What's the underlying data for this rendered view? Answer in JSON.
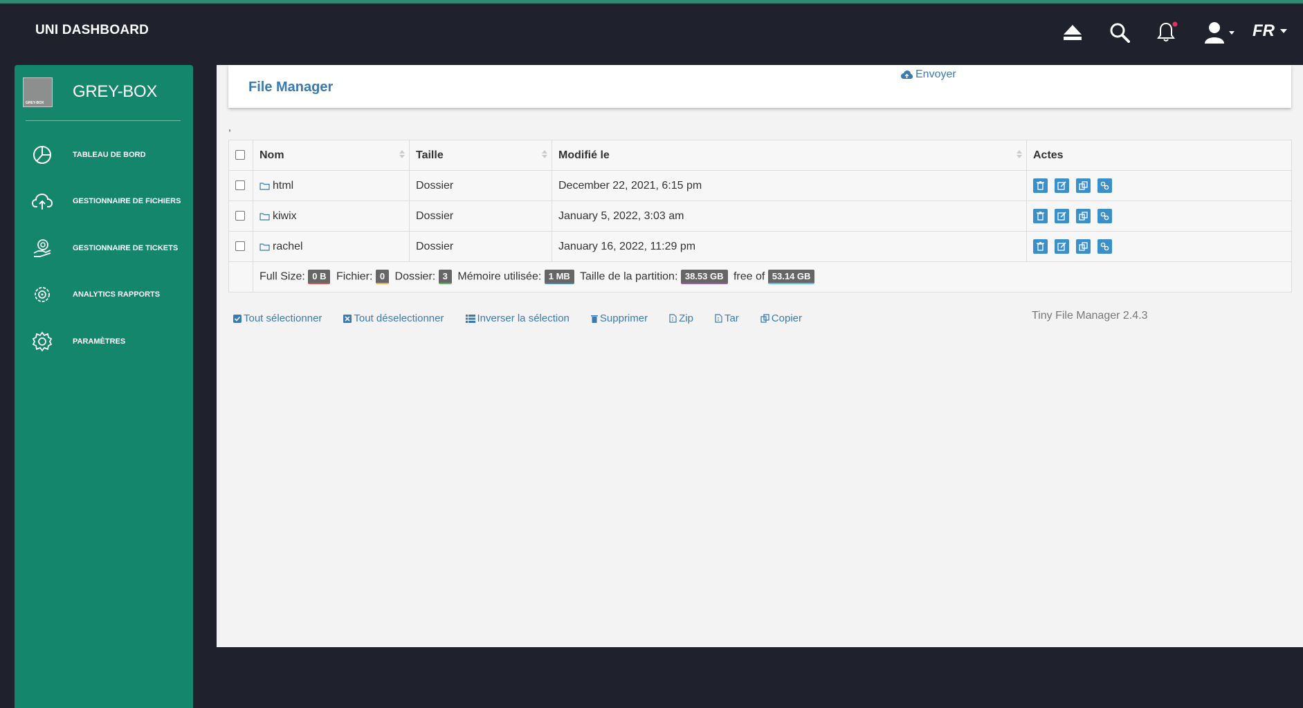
{
  "topbar": {
    "brand": "UNI DASHBOARD",
    "lang": "FR"
  },
  "sidebar": {
    "title": "GREY-BOX",
    "logo_text": "GREY-BOX",
    "items": [
      {
        "label": "TABLEAU DE BORD",
        "icon": "dashboard-icon"
      },
      {
        "label": "GESTIONNAIRE DE FICHIERS",
        "icon": "cloud-upload-icon"
      },
      {
        "label": "GESTIONNAIRE DE TICKETS",
        "icon": "ticket-icon"
      },
      {
        "label": "ANALYTICS RAPPORTS",
        "icon": "analytics-gear-icon"
      },
      {
        "label": "PARAMÈTRES",
        "icon": "settings-icon"
      }
    ]
  },
  "file_manager": {
    "title": "File Manager",
    "upload_label": "Envoyer",
    "tick": ",",
    "columns": {
      "name": "Nom",
      "size": "Taille",
      "modified": "Modifié le",
      "actions": "Actes"
    },
    "rows": [
      {
        "name": "html",
        "size": "Dossier",
        "modified": "December 22, 2021, 6:15 pm"
      },
      {
        "name": "kiwix",
        "size": "Dossier",
        "modified": "January 5, 2022, 3:03 am"
      },
      {
        "name": "rachel",
        "size": "Dossier",
        "modified": "January 16, 2022, 11:29 pm"
      }
    ],
    "summary": {
      "full_size_label": "Full Size:",
      "full_size": "0 B",
      "files_label": "Fichier:",
      "files": "0",
      "folders_label": "Dossier:",
      "folders": "3",
      "memory_label": "Mémoire utilisée:",
      "memory": "1 MB",
      "partition_label": "Taille de la partition:",
      "partition": "38.53 GB",
      "free_label": "free of",
      "total": "53.14 GB"
    },
    "bottom_actions": {
      "select_all": "Tout sélectionner",
      "unselect_all": "Tout déselectionner",
      "invert": "Inverser la sélection",
      "delete": "Supprimer",
      "zip": "Zip",
      "tar": "Tar",
      "copy": "Copier"
    },
    "version": "Tiny File Manager 2.4.3"
  },
  "colors": {
    "sidebar": "#14866b",
    "background": "#1f222d",
    "accent": "#3a7ab1",
    "action_button": "#3a8fc9"
  }
}
